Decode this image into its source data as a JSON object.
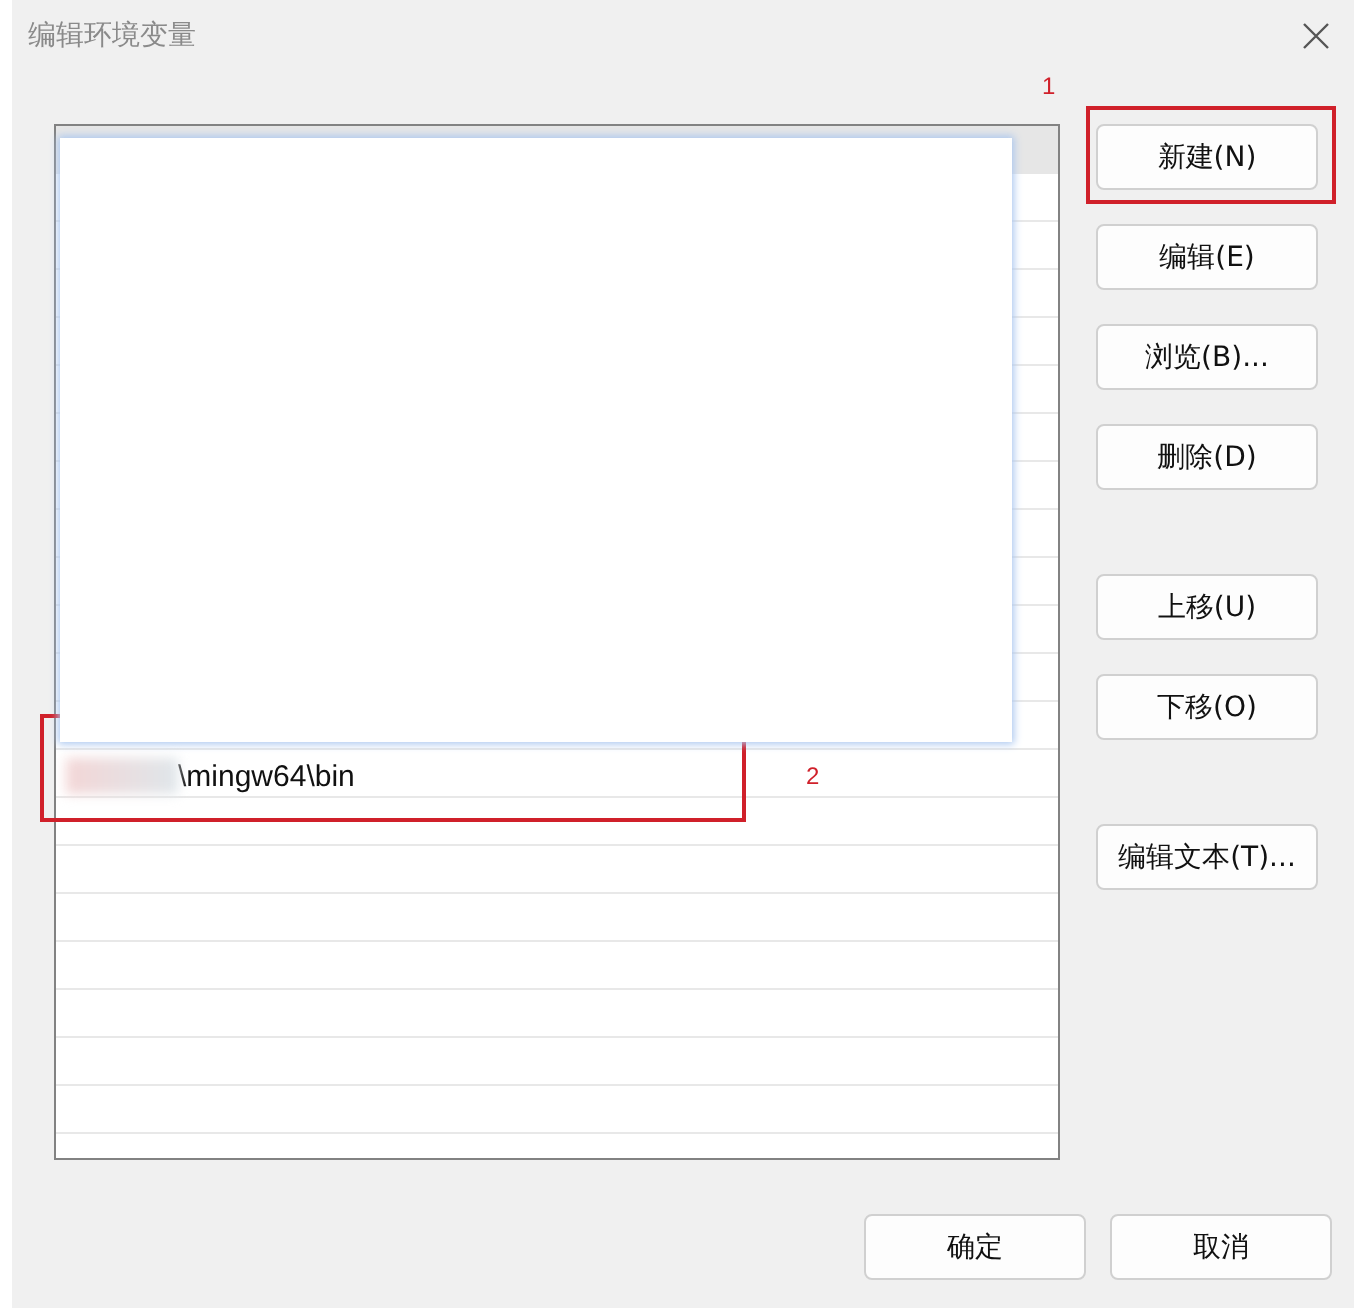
{
  "window": {
    "title": "编辑环境变量"
  },
  "path_list": {
    "rows": [
      {
        "text": "\\mingw64\\bin",
        "redacted_prefix": true,
        "annotation": "2"
      }
    ]
  },
  "button_groups": [
    [
      {
        "label": "新建(N)",
        "annotation": "1"
      },
      {
        "label": "编辑(E)"
      },
      {
        "label": "浏览(B)..."
      },
      {
        "label": "删除(D)"
      }
    ],
    [
      {
        "label": "上移(U)"
      },
      {
        "label": "下移(O)"
      }
    ],
    [
      {
        "label": "编辑文本(T)..."
      }
    ]
  ],
  "dialog_buttons": [
    "确定",
    "取消"
  ]
}
